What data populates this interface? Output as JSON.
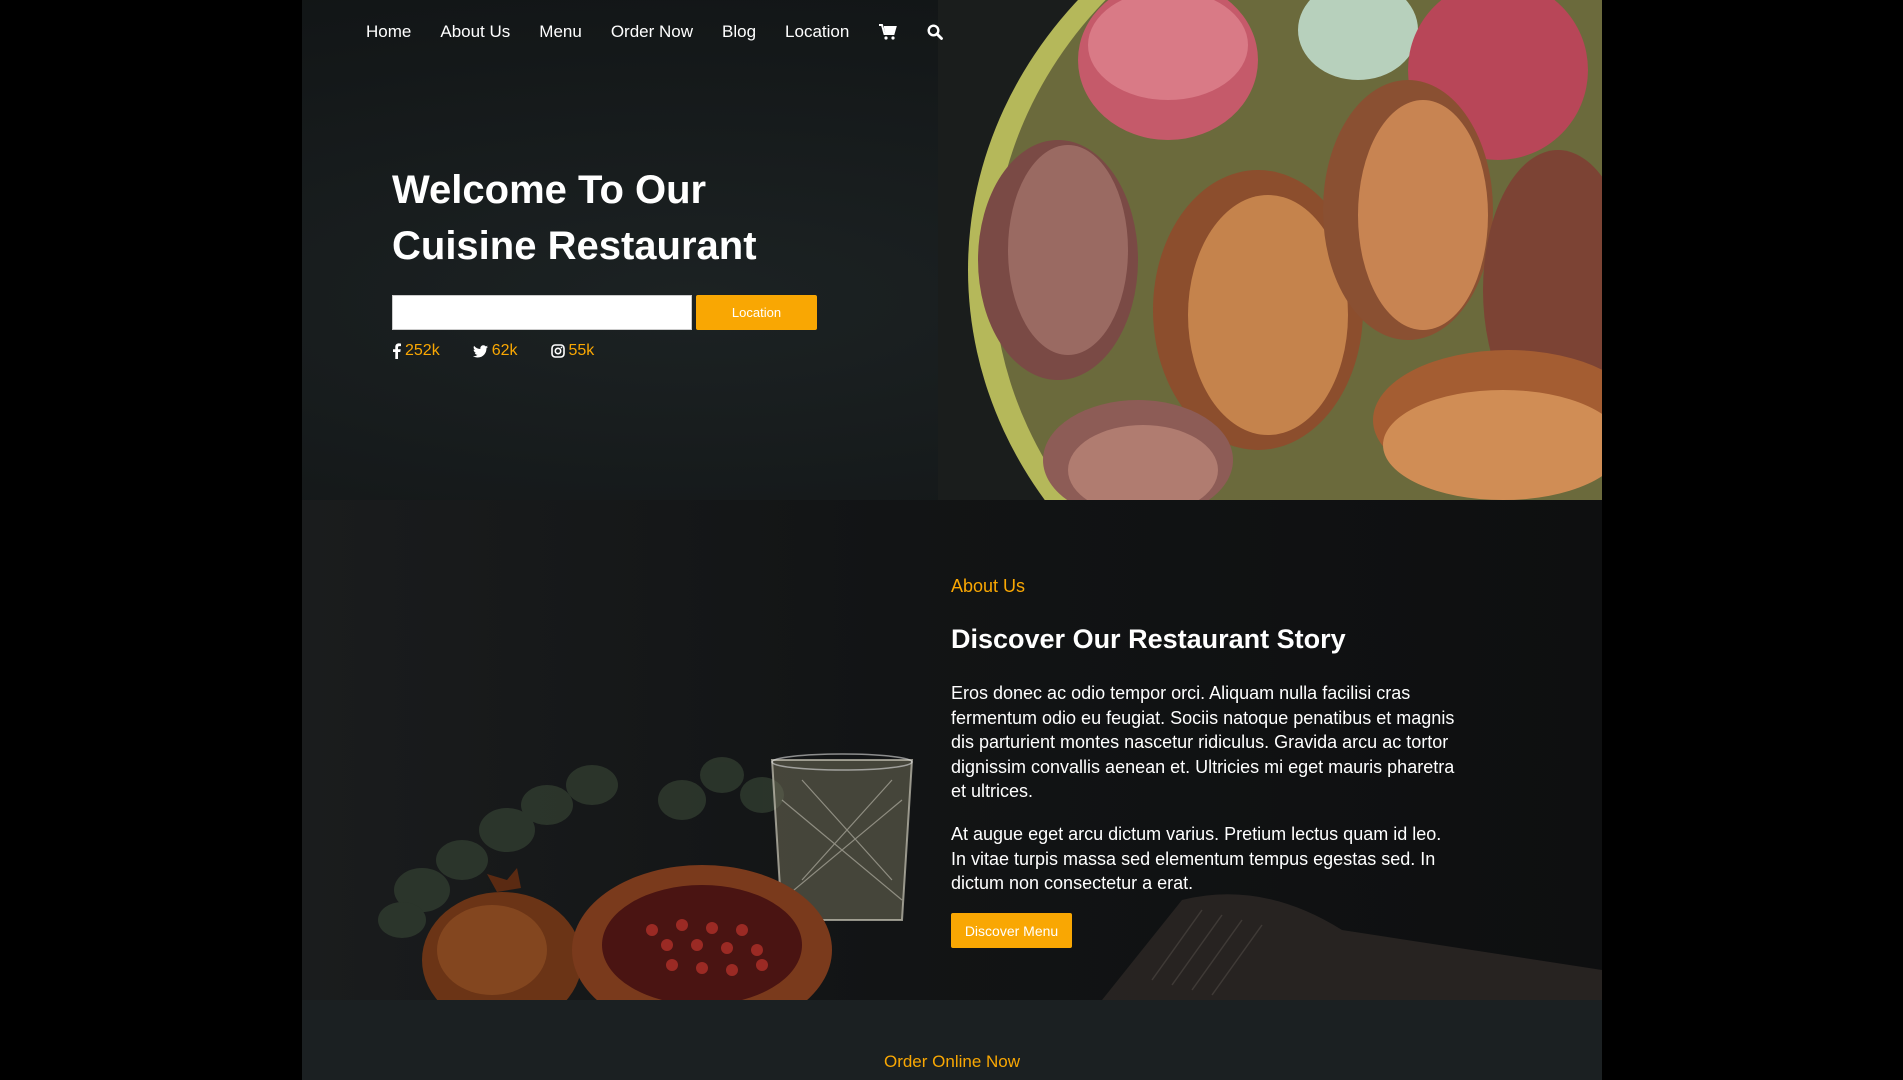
{
  "nav": {
    "links": [
      "Home",
      "About Us",
      "Menu",
      "Order Now",
      "Blog",
      "Location"
    ],
    "icons": [
      "cart-icon",
      "search-icon"
    ]
  },
  "hero": {
    "title_line1": "Welcome To Our",
    "title_line2": "Cuisine Restaurant",
    "input_value": "",
    "button_label": "Location",
    "socials": [
      {
        "icon": "facebook-icon",
        "count": "252k"
      },
      {
        "icon": "twitter-icon",
        "count": "62k"
      },
      {
        "icon": "instagram-icon",
        "count": "55k"
      }
    ]
  },
  "about": {
    "eyebrow": "About Us",
    "heading": "Discover Our Restaurant Story",
    "paragraph1": "Eros donec ac odio tempor orci. Aliquam nulla facilisi cras fermentum odio eu feugiat. Sociis natoque penatibus et magnis dis parturient montes nascetur ridiculus. Gravida arcu ac tortor dignissim convallis aenean et. Ultricies mi eget mauris pharetra et ultrices.",
    "paragraph2": "At augue eget arcu dictum varius. Pretium lectus quam id leo. In vitae turpis massa sed elementum tempus egestas sed. In dictum non consectetur a erat.",
    "button_label": "Discover Menu"
  },
  "order": {
    "eyebrow": "Order Online Now"
  },
  "colors": {
    "accent": "#f9a703",
    "background": "#000000",
    "hero_bg": "#141819",
    "order_bg": "#1b2022"
  }
}
